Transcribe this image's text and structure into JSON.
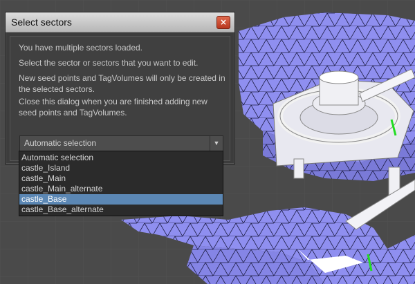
{
  "dialog": {
    "title": "Select sectors",
    "close_label": "×",
    "paragraphs": [
      "You have multiple sectors loaded.",
      "Select the sector or sectors that you want to edit.",
      "New seed points and TagVolumes will only be created in the selected sectors.",
      "Close this dialog when you are finished adding new seed points and TagVolumes."
    ],
    "dropdown": {
      "value": "Automatic selection",
      "arrow": "▼"
    },
    "options": [
      "Automatic selection",
      "castle_Island",
      "castle_Main",
      "castle_Main_alternate",
      "castle_Base",
      "castle_Base_alternate"
    ],
    "selected_option": "castle_Base"
  },
  "colors": {
    "navmesh": "#8f8ff0",
    "viewport_bg": "#4a4a4a",
    "selection": "#5b87b4",
    "seed_marker": "#22dd22"
  }
}
